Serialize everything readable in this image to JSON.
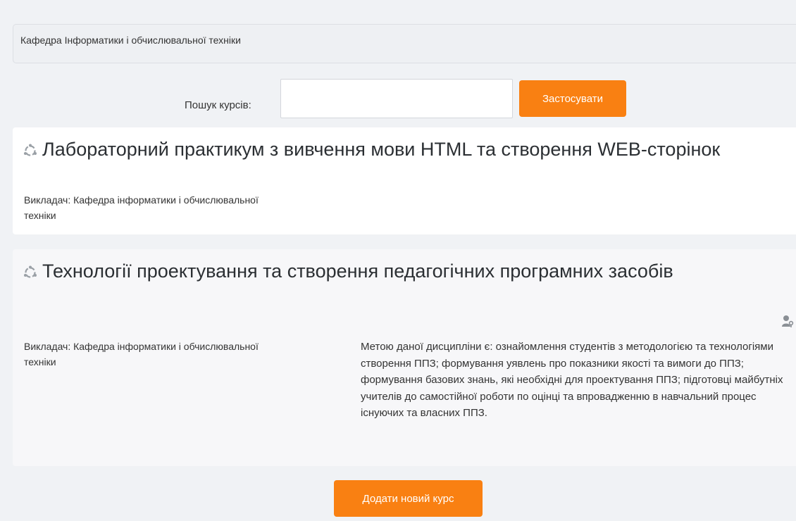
{
  "category": {
    "description": "Кафедра Інформатики і обчислювальної техніки"
  },
  "search": {
    "label": "Пошук курсів:",
    "value": "",
    "placeholder": "",
    "button_label": "Застосувати"
  },
  "courses": [
    {
      "title": "Лабораторний практикум з вивчення мови HTML та створення WEB-сторінок",
      "icon": "course-icon",
      "teacher": "Викладач: Кафедра інформатики і обчислювальної техніки"
    },
    {
      "title": "Технології проектування та створення педагогічних програмних засобів",
      "icon": "course-icon",
      "teacher": "Викладач: Кафедра інформатики і обчислювальної техніки",
      "summary": "Метою даної дисципліни є: ознайомлення студентів з методологією та технологіями створення ППЗ; формування уявлень про показники якості та вимоги до ППЗ; формування базових знань, які необхідні для проектування ППЗ; підготовці майбутніх учителів до самостійної роботи по оцінці та впровадженню в навчальний процес існуючих та власних ППЗ.",
      "enrol_icon": "guest-access-key-icon"
    }
  ],
  "actions": {
    "add_course_label": "Додати новий курс"
  },
  "colors": {
    "accent": "#f98012",
    "page_background": "#f0f2f5"
  }
}
